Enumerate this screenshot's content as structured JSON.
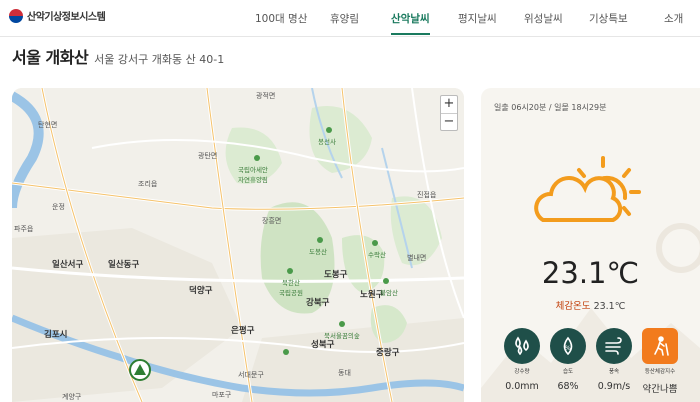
{
  "header": {
    "logo_text": "산악기상정보시스템",
    "nav": [
      "100대 명산",
      "휴양림",
      "산악날씨",
      "평지날씨",
      "위성날씨",
      "기상특보",
      "소개"
    ],
    "active_nav": "산악날씨"
  },
  "mountain": {
    "name": "서울 개화산",
    "address": "서울 강서구 개화동 산 40-1"
  },
  "map": {
    "zoom_in": "+",
    "zoom_out": "−",
    "labels": [
      {
        "id": "gimpo",
        "text": "김포시",
        "size": "big"
      },
      {
        "id": "ilsan",
        "text": "일산동구",
        "size": "big"
      },
      {
        "id": "ilsanseo",
        "text": "일산서구",
        "size": "big"
      },
      {
        "id": "deogyang",
        "text": "덕양구",
        "size": "big"
      },
      {
        "id": "eunpyeong",
        "text": "은평구",
        "size": "big"
      },
      {
        "id": "dobong",
        "text": "도봉구",
        "size": "big"
      },
      {
        "id": "nowon",
        "text": "노원구",
        "size": "big"
      },
      {
        "id": "gangbuk",
        "text": "강북구",
        "size": "big"
      },
      {
        "id": "seongbuk",
        "text": "성북구",
        "size": "big"
      },
      {
        "id": "jungnang",
        "text": "중랑구",
        "size": "big"
      },
      {
        "id": "jangheung",
        "text": "장흥면",
        "size": "normal"
      },
      {
        "id": "gwangtan",
        "text": "광탄면",
        "size": "normal"
      },
      {
        "id": "jori",
        "text": "조리읍",
        "size": "normal"
      },
      {
        "id": "paju",
        "text": "파주읍",
        "size": "normal"
      },
      {
        "id": "tanhyeon",
        "text": "탄현면",
        "size": "normal"
      },
      {
        "id": "beolmun",
        "text": "별내면",
        "size": "normal"
      },
      {
        "id": "jinjeop",
        "text": "진접읍",
        "size": "normal"
      },
      {
        "id": "seodaemun",
        "text": "서대문구",
        "size": "normal"
      },
      {
        "id": "mapo",
        "text": "마포구",
        "size": "normal"
      },
      {
        "id": "gyeyang",
        "text": "계양구",
        "size": "normal"
      },
      {
        "id": "dongdaemun",
        "text": "동대",
        "size": "normal"
      },
      {
        "id": "gwangjeok",
        "text": "광적면",
        "size": "normal"
      },
      {
        "id": "unjeong",
        "text": "운정",
        "size": "normal"
      }
    ],
    "parks": [
      {
        "id": "suribong",
        "text": "국립아세안\n자연휴양림"
      },
      {
        "id": "dobongsan",
        "text": "도봉산"
      },
      {
        "id": "bukhan",
        "text": "북한산\n국립공원"
      },
      {
        "id": "suraksan",
        "text": "수락산"
      },
      {
        "id": "bulamsan",
        "text": "불암산"
      },
      {
        "id": "bukseoul",
        "text": "북서울꿈의숲"
      },
      {
        "id": "bongseonsa",
        "text": "봉선사"
      }
    ]
  },
  "weather": {
    "sunrise_sunset": "일출 06시20분 / 일몰 18시29분",
    "temperature": "23.1℃",
    "feels_label": "체감온도",
    "feels_value": "23.1℃",
    "icon": "partly-cloudy-sun-icon",
    "stats": [
      {
        "id": "precip",
        "label": "강수량",
        "value": "0.0mm",
        "icon": "raindrops-icon"
      },
      {
        "id": "humidity",
        "label": "습도",
        "value": "68%",
        "icon": "humidity-drop-icon"
      },
      {
        "id": "wind",
        "label": "풍속",
        "value": "0.9m/s",
        "icon": "wind-icon"
      },
      {
        "id": "hiking",
        "label": "등산체감지수",
        "value": "약간나쁨",
        "icon": "hiker-icon"
      }
    ],
    "colors": {
      "accent": "#f39c1d",
      "stat_circle": "#1f4f49",
      "hiking_box": "#f27b1d",
      "feels": "#c2410c"
    }
  }
}
